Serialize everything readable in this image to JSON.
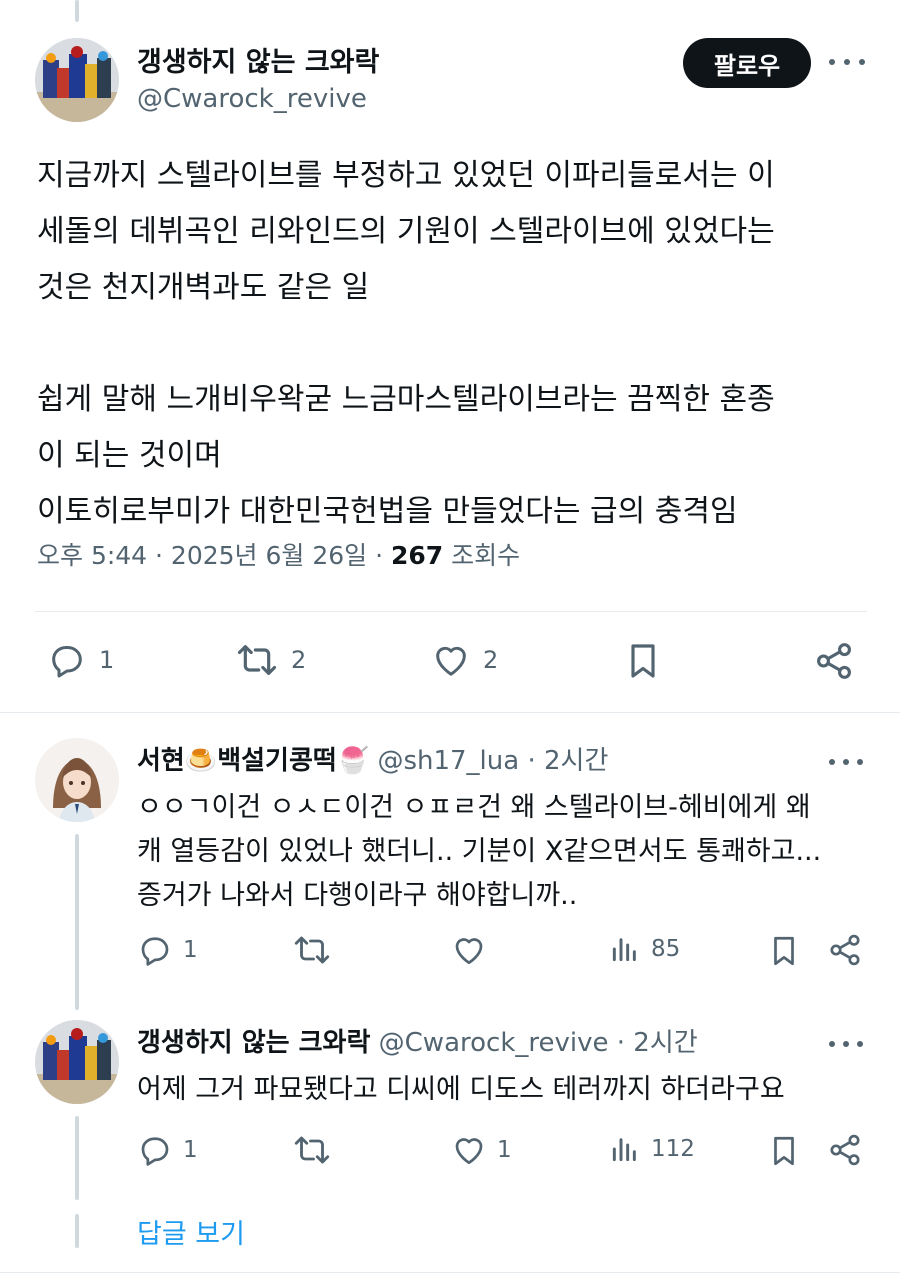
{
  "main_post": {
    "author_name": "갱생하지 않는 크와락",
    "author_handle": "@Cwarock_revive",
    "follow_label": "팔로우",
    "text": "지금까지 스텔라이브를 부정하고 있었던 이파리들로서는 이\n세돌의 데뷔곡인 리와인드의 기원이 스텔라이브에 있었다는\n것은 천지개벽과도 같은 일\n\n쉽게 말해 느개비우왁굳 느금마스텔라이브라는 끔찍한 혼종\n이 되는 것이며\n이토히로부미가 대한민국헌법을 만들었다는 급의 충격임",
    "timestamp": "오후 5:44 · 2025년 6월 26일 ·",
    "views_count": "267",
    "views_label": "조회수",
    "replies": "1",
    "reposts": "2",
    "likes": "2"
  },
  "replies": [
    {
      "author_name": "서현🍮백설기콩떡🍧",
      "author_handle": "@sh17_lua · 2시간",
      "text": "ㅇㅇㄱ이건 ㅇㅅㄷ이건 ㅇㅍㄹ건 왜 스텔라이브-헤비에게 왜\n캐 열등감이 있었나 했더니.. 기분이 X같으면서도 통쾌하고...\n증거가 나와서 다행이라구 해야합니까..",
      "replies": "1",
      "reposts": "",
      "likes": "",
      "views": "85"
    },
    {
      "author_name": "갱생하지 않는 크와락",
      "author_handle": "@Cwarock_revive · 2시간",
      "text": "어제 그거 파묘됐다고 디씨에 디도스 테러까지 하더라구요",
      "replies": "1",
      "reposts": "",
      "likes": "1",
      "views": "112"
    }
  ],
  "view_replies_label": "답글 보기",
  "colors": {
    "text": "#0f1419",
    "secondary": "#536471",
    "link": "#1d9bf0",
    "divider": "#e6ecf0",
    "thread_line": "#cfd9de"
  }
}
